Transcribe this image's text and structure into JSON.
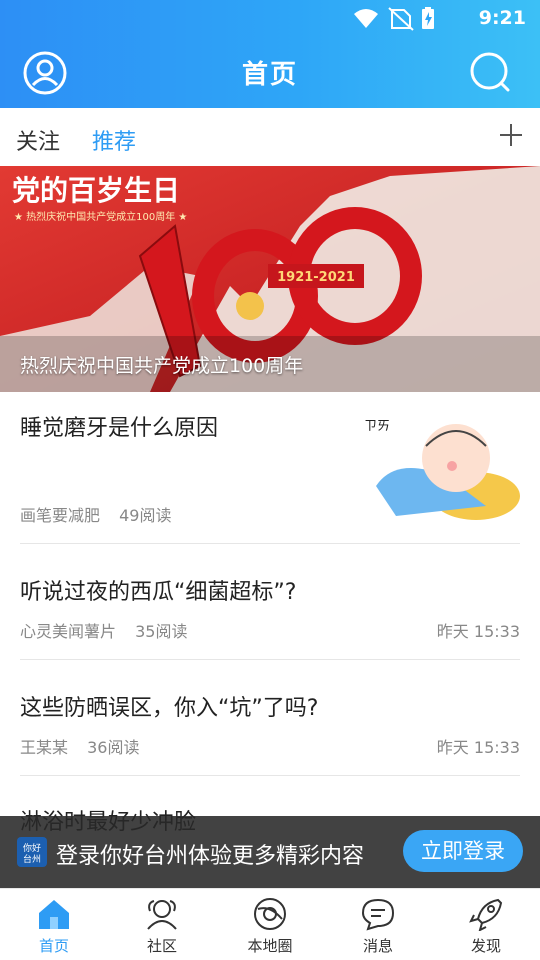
{
  "status_bar": {
    "time": "9:21"
  },
  "header": {
    "title": "首页"
  },
  "tabs": [
    {
      "label": "关注"
    },
    {
      "label": "推荐"
    }
  ],
  "banner": {
    "caption": "热烈庆祝中国共产党成立100周年",
    "headline": "党的百岁生日",
    "subline": "★ 热烈庆祝中国共产党成立100周年 ★",
    "years": "1921-2021"
  },
  "articles": [
    {
      "title": "睡觉磨牙是什么原因",
      "author": "画笔要减肥",
      "reads": "49阅读",
      "time": ""
    },
    {
      "title": "听说过夜的西瓜“细菌超标”?",
      "author": "心灵美闻薯片",
      "reads": "35阅读",
      "time": "昨天 15:33"
    },
    {
      "title": "这些防晒误区，你入“坑”了吗?",
      "author": "王某某",
      "reads": "36阅读",
      "time": "昨天 15:33"
    },
    {
      "title": "淋浴时最好少冲脸",
      "author": "",
      "reads": "",
      "time": ""
    }
  ],
  "login_bar": {
    "logo_text": "你好台州",
    "text": "登录你好台州体验更多精彩内容",
    "button": "立即登录"
  },
  "bottom_nav": [
    {
      "label": "首页",
      "icon": "home-icon"
    },
    {
      "label": "社区",
      "icon": "community-icon"
    },
    {
      "label": "本地圈",
      "icon": "local-circle-icon"
    },
    {
      "label": "消息",
      "icon": "message-icon"
    },
    {
      "label": "发现",
      "icon": "rocket-icon"
    }
  ],
  "colors": {
    "primary": "#2e9cf4",
    "header_start": "#2d8ff5",
    "header_end": "#3cc0f6"
  }
}
